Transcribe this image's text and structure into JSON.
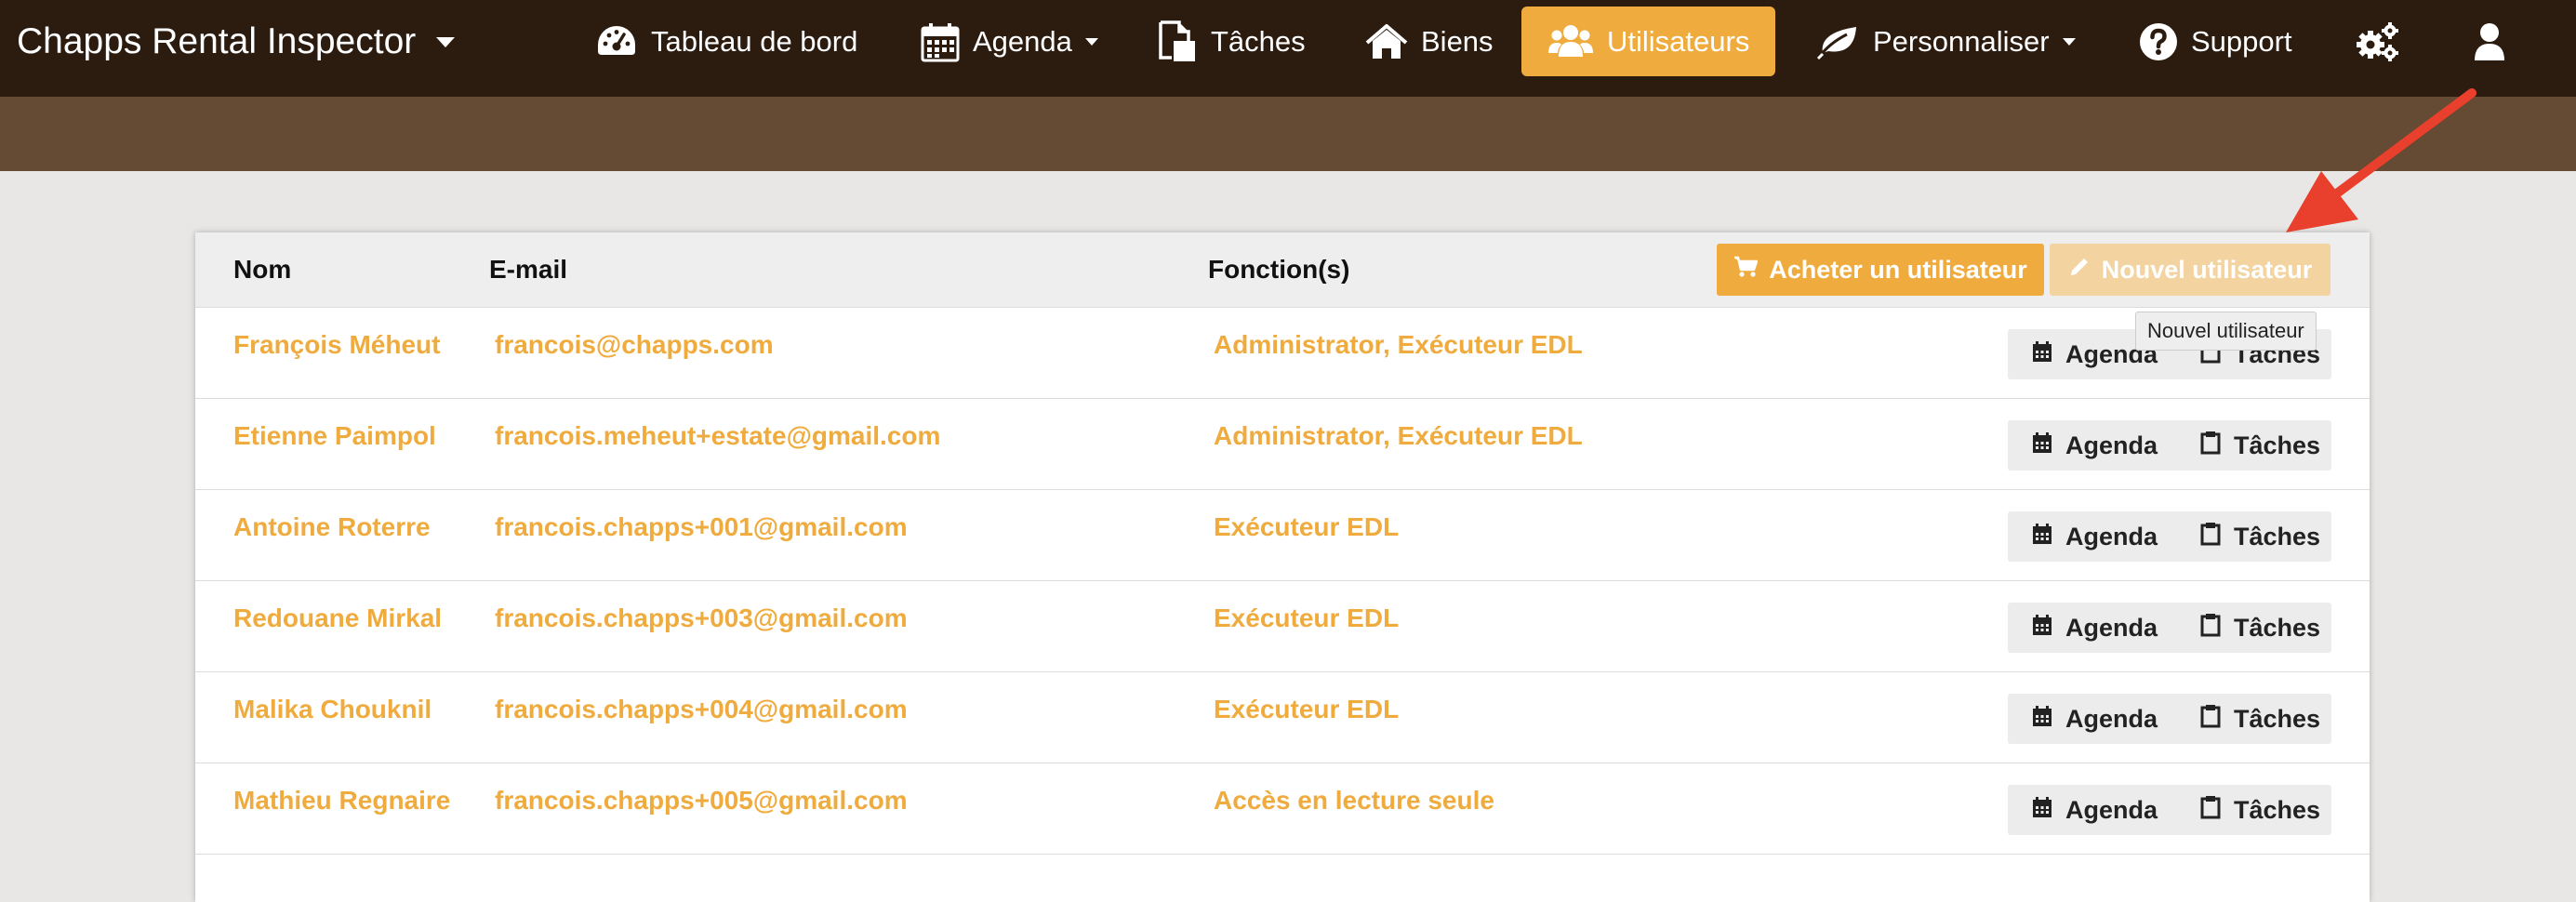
{
  "app": {
    "title": "Chapps Rental Inspector"
  },
  "nav": {
    "items": [
      {
        "label": "Tableau de bord",
        "icon": "dashboard-icon"
      },
      {
        "label": "Agenda",
        "icon": "calendar-icon",
        "has_dropdown": true
      },
      {
        "label": "Tâches",
        "icon": "tasks-icon"
      },
      {
        "label": "Biens",
        "icon": "home-icon"
      },
      {
        "label": "Utilisateurs",
        "icon": "users-icon",
        "active": true
      },
      {
        "label": "Personnaliser",
        "icon": "leaf-icon",
        "has_dropdown": true
      },
      {
        "label": "Support",
        "icon": "help-icon"
      }
    ],
    "settings_icon": "gears-icon",
    "account_icon": "user-icon"
  },
  "colors": {
    "accent": "#efab3d",
    "nav_bg": "#2c1c10",
    "banner_bg": "#654a34",
    "arrow": "#e8402c"
  },
  "table": {
    "headers": {
      "name": "Nom",
      "email": "E-mail",
      "roles": "Fonction(s)"
    },
    "buy_button": "Acheter un utilisateur",
    "new_button": "Nouvel utilisateur",
    "tooltip": "Nouvel utilisateur",
    "agenda_label": "Agenda",
    "tasks_label": "Tâches",
    "rows": [
      {
        "name": "François Méheut",
        "email": "francois@chapps.com",
        "roles": "Administrator, Exécuteur EDL"
      },
      {
        "name": "Etienne Paimpol",
        "email": "francois.meheut+estate@gmail.com",
        "roles": "Administrator, Exécuteur EDL"
      },
      {
        "name": "Antoine Roterre",
        "email": "francois.chapps+001@gmail.com",
        "roles": "Exécuteur EDL"
      },
      {
        "name": "Redouane Mirkal",
        "email": "francois.chapps+003@gmail.com",
        "roles": "Exécuteur EDL"
      },
      {
        "name": "Malika Chouknil",
        "email": "francois.chapps+004@gmail.com",
        "roles": "Exécuteur EDL"
      },
      {
        "name": "Mathieu Regnaire",
        "email": "francois.chapps+005@gmail.com",
        "roles": "Accès en lecture seule"
      }
    ]
  }
}
